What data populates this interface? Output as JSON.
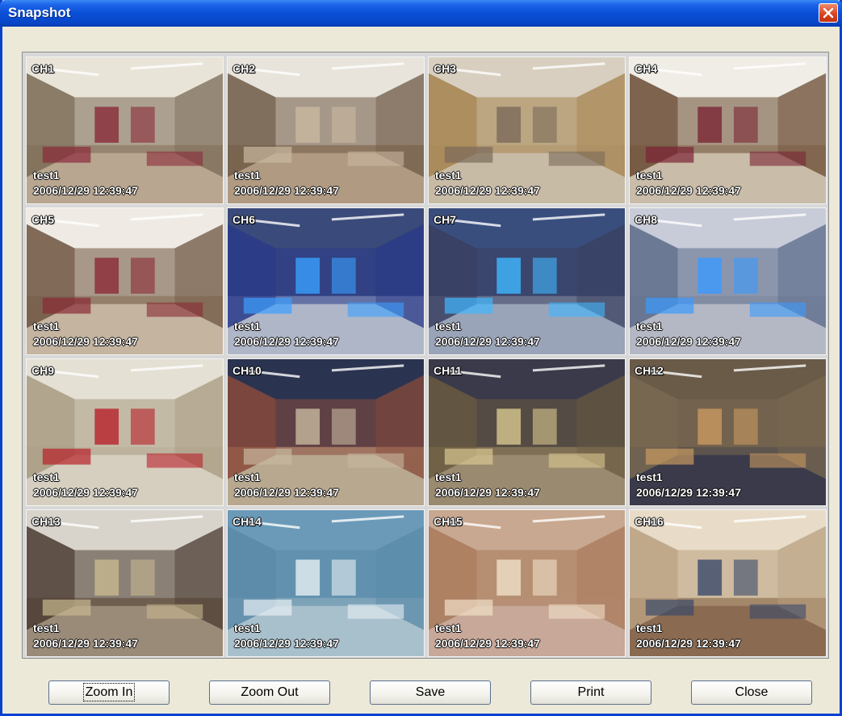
{
  "window": {
    "title": "Snapshot"
  },
  "channels": [
    {
      "ch": "CH1",
      "cam": "test1",
      "ts": "2006/12/29 12:39:47",
      "sky": "#e9e4d8",
      "floor": "#b8a690",
      "wall": "#7a6a55",
      "accent": "#8a2a3a"
    },
    {
      "ch": "CH2",
      "cam": "test1",
      "ts": "2006/12/29 12:39:47",
      "sky": "#e8e4dc",
      "floor": "#b09a82",
      "wall": "#6f5a46",
      "accent": "#c9b8a0"
    },
    {
      "ch": "CH3",
      "cam": "test1",
      "ts": "2006/12/29 12:39:47",
      "sky": "#d8cfc0",
      "floor": "#c8bba6",
      "wall": "#a5834d",
      "accent": "#7a6a5a"
    },
    {
      "ch": "CH4",
      "cam": "test1",
      "ts": "2006/12/29 12:39:47",
      "sky": "#f0ede6",
      "floor": "#c9bca8",
      "wall": "#6a4a32",
      "accent": "#7a2434"
    },
    {
      "ch": "CH5",
      "cam": "test1",
      "ts": "2006/12/29 12:39:47",
      "sky": "#efebe4",
      "floor": "#c4b4a0",
      "wall": "#6e5440",
      "accent": "#8a2a34"
    },
    {
      "ch": "CH6",
      "cam": "test1",
      "ts": "2006/12/29 12:39:47",
      "sky": "#3a4a7a",
      "floor": "#aeb6c8",
      "wall": "#2a3a8a",
      "accent": "#3aa0ff"
    },
    {
      "ch": "CH7",
      "cam": "test1",
      "ts": "2006/12/29 12:39:47",
      "sky": "#3a4e7e",
      "floor": "#9aa4b8",
      "wall": "#3a4060",
      "accent": "#40b8ff"
    },
    {
      "ch": "CH8",
      "cam": "test1",
      "ts": "2006/12/29 12:39:47",
      "sky": "#c8ccd8",
      "floor": "#b4b8c4",
      "wall": "#5a6a8a",
      "accent": "#3a9aff"
    },
    {
      "ch": "CH9",
      "cam": "test1",
      "ts": "2006/12/29 12:39:47",
      "sky": "#e4e0d4",
      "floor": "#d6cfc0",
      "wall": "#a89a80",
      "accent": "#b8202a"
    },
    {
      "ch": "CH10",
      "cam": "test1",
      "ts": "2006/12/29 12:39:47",
      "sky": "#2a3450",
      "floor": "#b8a890",
      "wall": "#8a4a3a",
      "accent": "#c8b8a0"
    },
    {
      "ch": "CH11",
      "cam": "test1",
      "ts": "2006/12/29 12:39:47",
      "sky": "#3a3a4a",
      "floor": "#9a8a70",
      "wall": "#6a5a40",
      "accent": "#d8c890"
    },
    {
      "ch": "CH12",
      "cam": "test1",
      "ts": "2006/12/29 12:39:47",
      "sky": "#6a5a48",
      "floor": "#3a3a4a",
      "wall": "#7a6a52",
      "accent": "#c89a60"
    },
    {
      "ch": "CH13",
      "cam": "test1",
      "ts": "2006/12/29 12:39:47",
      "sky": "#d8d4cc",
      "floor": "#9a8a78",
      "wall": "#4a3a30",
      "accent": "#c8b890"
    },
    {
      "ch": "CH14",
      "cam": "test1",
      "ts": "2006/12/29 12:39:47",
      "sky": "#6a9ab8",
      "floor": "#a8c0cc",
      "wall": "#5a8aa8",
      "accent": "#e8f0f4"
    },
    {
      "ch": "CH15",
      "cam": "test1",
      "ts": "2006/12/29 12:39:47",
      "sky": "#c8a890",
      "floor": "#c8a898",
      "wall": "#a87a5a",
      "accent": "#f0e0c8"
    },
    {
      "ch": "CH16",
      "cam": "test1",
      "ts": "2006/12/29 12:39:47",
      "sky": "#e8dcc8",
      "floor": "#8a6a50",
      "wall": "#b8a080",
      "accent": "#3a4a6a"
    }
  ],
  "buttons": {
    "zoom_in": "Zoom In",
    "zoom_out": "Zoom Out",
    "save": "Save",
    "print": "Print",
    "close": "Close"
  },
  "icons": {
    "close": "close-x-icon"
  }
}
